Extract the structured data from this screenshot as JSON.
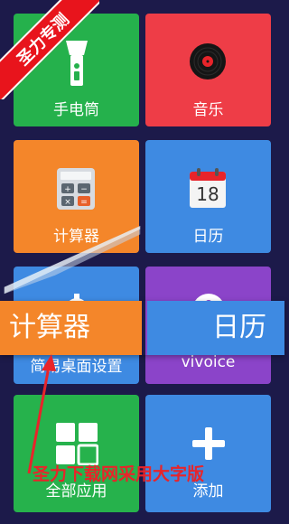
{
  "tiles": {
    "flashlight": {
      "label": "手电筒",
      "color": "#25b14c",
      "icon": "flashlight-icon"
    },
    "music": {
      "label": "音乐",
      "color": "#ee3d47",
      "icon": "vinyl-record-icon"
    },
    "calculator": {
      "label": "计算器",
      "color": "#f4862a",
      "icon": "calculator-icon"
    },
    "calendar": {
      "label": "日历",
      "color": "#3e8ae2",
      "icon": "calendar-icon",
      "day": "18"
    },
    "settings": {
      "label": "简易桌面设置",
      "color": "#3e8ae2",
      "icon": "gear-icon"
    },
    "vivoice": {
      "label": "vivoice",
      "color": "#8b44c9",
      "icon": "microphone-icon"
    },
    "allapps": {
      "label": "全部应用",
      "color": "#26b24c",
      "icon": "app-grid-icon"
    },
    "add": {
      "label": "添加",
      "color": "#3e8ae2",
      "icon": "plus-icon"
    }
  },
  "zoom": {
    "left_label": "计算器",
    "right_label": "日历"
  },
  "ribbon": {
    "text": "圣力专测",
    "color": "#e8141c"
  },
  "watermark": {
    "text": "圣力下载网采用大字版",
    "color": "#e8242a"
  },
  "background_color": "#1c1a4a"
}
